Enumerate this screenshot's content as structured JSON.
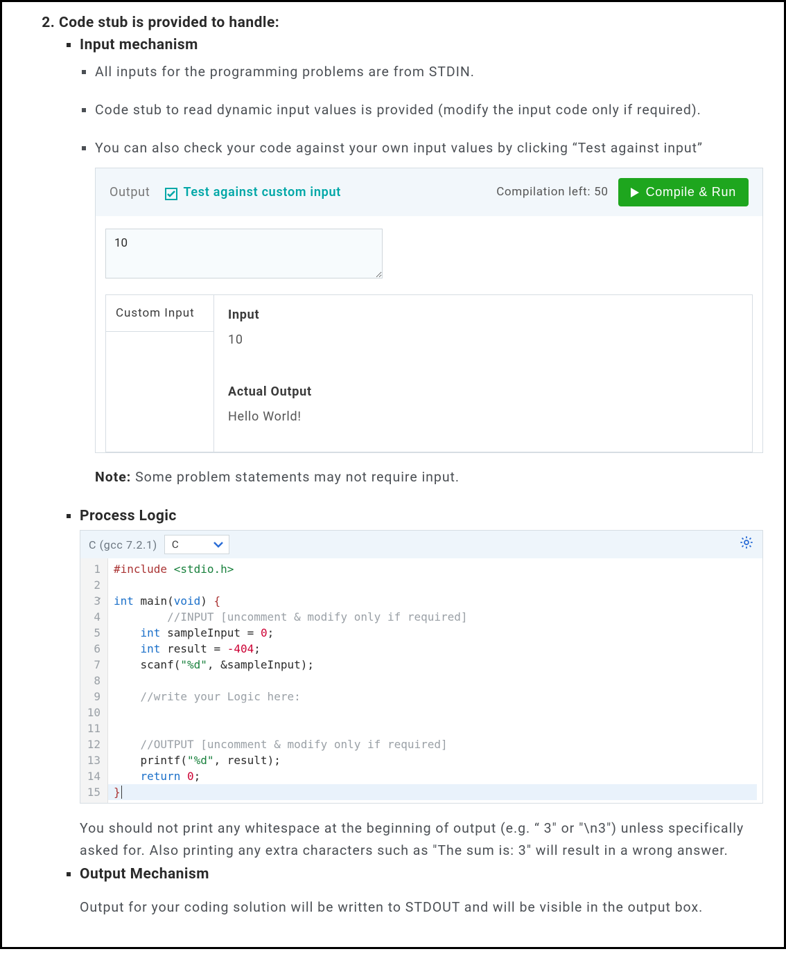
{
  "item_number": "2.",
  "heading": "Code stub is provided to handle:",
  "sections": {
    "input_mech": {
      "title": "Input mechanism",
      "bullets": [
        "All inputs for the programming problems are from STDIN.",
        "Code stub to read dynamic input values is provided (modify the input code only if required).",
        "You can also check your code against your own input values by clicking “Test against input”"
      ]
    },
    "process": {
      "title": "Process Logic",
      "para": "You should not print any whitespace at the beginning of output (e.g. “ 3\" or \"\\n3\") unless specifically asked for. Also printing any extra characters such as \"The sum is: 3\" will result in a wrong answer."
    },
    "output_mech": {
      "title": "Output Mechanism",
      "para": "Output for your coding solution will be written to STDOUT and will be visible in the output box."
    }
  },
  "compile_panel": {
    "output_label": "Output",
    "checkbox_label": "Test against custom input",
    "checkbox_checked": true,
    "compilation_left_label": "Compilation left: ",
    "compilation_left_value": "50",
    "button_label": "Compile & Run",
    "textarea_value": "10",
    "custom_input_label": "Custom Input",
    "io": {
      "input_label": "Input",
      "input_value": "10",
      "actual_output_label": "Actual Output",
      "actual_output_value": "Hello World!"
    }
  },
  "note": {
    "prefix": "Note:",
    "text": " Some problem statements may not require input."
  },
  "editor": {
    "compiler": "C (gcc 7.2.1)",
    "language": "C",
    "code_lines": [
      "#include <stdio.h>",
      "",
      "int main(void) {",
      "        //INPUT [uncomment & modify only if required]",
      "    int sampleInput = 0;",
      "    int result = -404;",
      "    scanf(\"%d\", &sampleInput);",
      "",
      "    //write your Logic here:",
      "",
      "",
      "    //OUTPUT [uncomment & modify only if required]",
      "    printf(\"%d\", result);",
      "    return 0;",
      "}"
    ],
    "line_count": 15
  }
}
